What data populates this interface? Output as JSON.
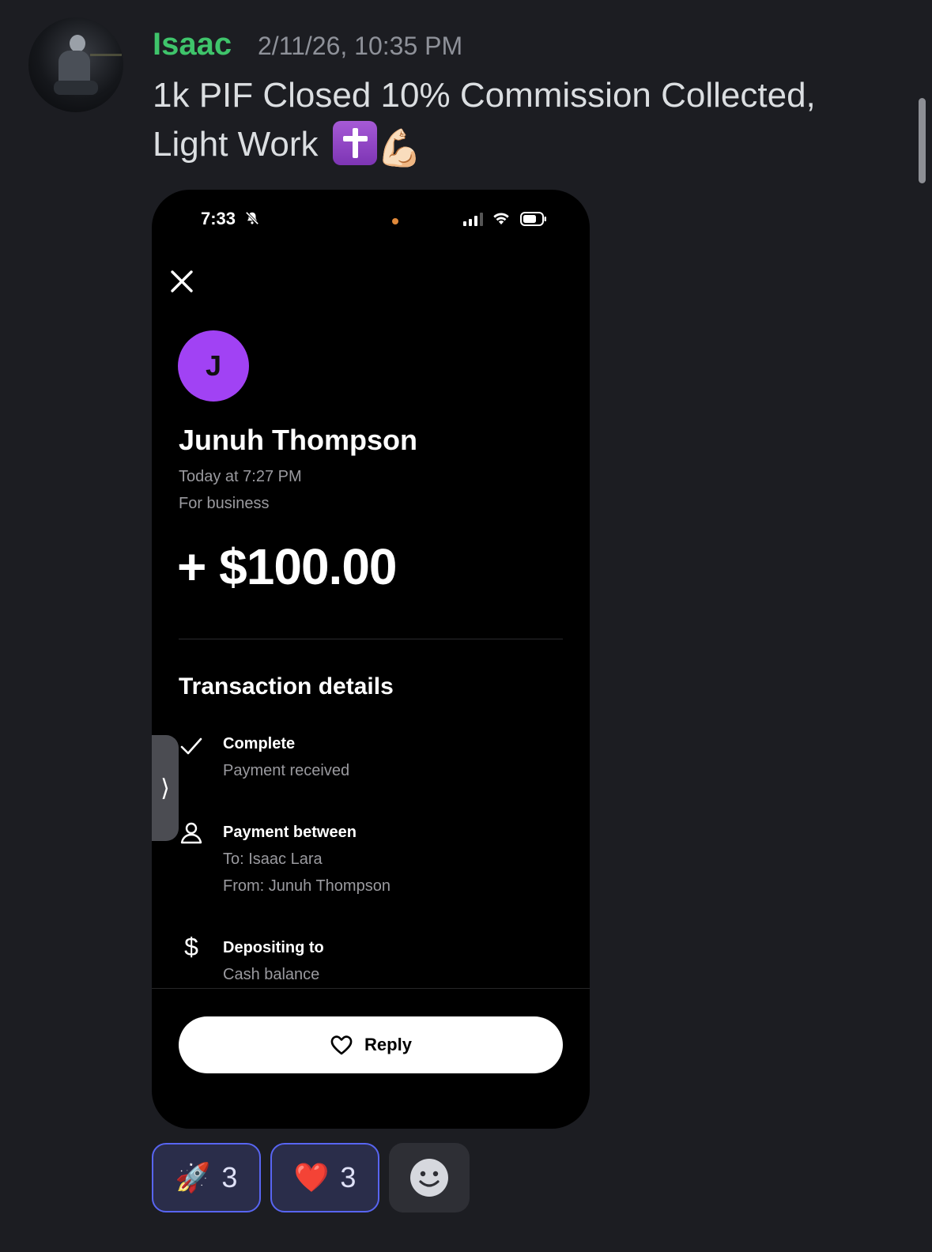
{
  "message": {
    "author": "Isaac",
    "timestamp": "2/11/26, 10:35 PM",
    "text_line1": "1k PIF Closed 10% Commission Collected,",
    "text_line2": "Light Work",
    "emojis": [
      "latin-cross-emoji",
      "flexed-biceps-emoji"
    ]
  },
  "attachment": {
    "status_bar": {
      "time": "7:33"
    },
    "payer_initial": "J",
    "payer_name": "Junuh Thompson",
    "date": "Today at 7:27 PM",
    "purpose": "For business",
    "amount": "+ $100.00",
    "section_title": "Transaction details",
    "details": [
      {
        "icon": "checkmark-icon",
        "title": "Complete",
        "lines": [
          "Payment received"
        ]
      },
      {
        "icon": "person-icon",
        "title": "Payment between",
        "lines": [
          "To: Isaac Lara",
          "From: Junuh Thompson"
        ]
      },
      {
        "icon": "dollar-icon",
        "title": "Depositing to",
        "lines": [
          "Cash balance"
        ]
      }
    ],
    "reply_label": "Reply",
    "accent_color": "#a142f4"
  },
  "reactions": [
    {
      "emoji": "🚀",
      "count": "3"
    },
    {
      "emoji": "❤️",
      "count": "3"
    }
  ]
}
